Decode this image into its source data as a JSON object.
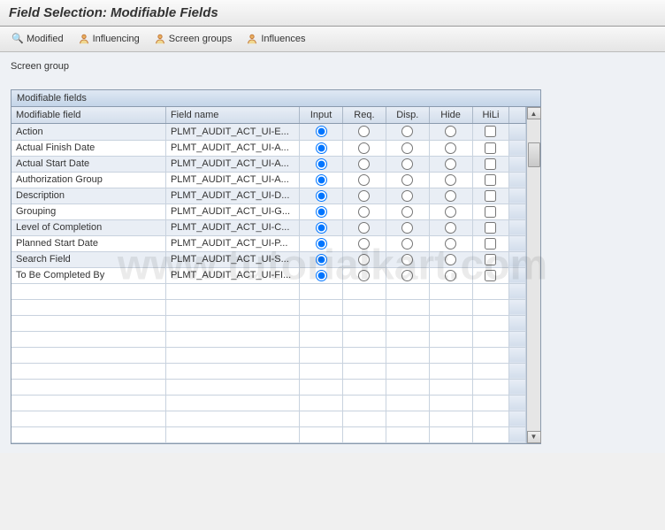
{
  "header": {
    "title": "Field Selection: Modifiable Fields"
  },
  "toolbar": [
    {
      "icon": "magnify",
      "label": "Modified"
    },
    {
      "icon": "person",
      "label": "Influencing"
    },
    {
      "icon": "person",
      "label": "Screen groups"
    },
    {
      "icon": "person",
      "label": "Influences"
    }
  ],
  "screen_group_label": "Screen group",
  "table": {
    "title": "Modifiable fields",
    "columns": {
      "field": "Modifiable field",
      "name": "Field name",
      "input": "Input",
      "req": "Req.",
      "disp": "Disp.",
      "hide": "Hide",
      "hili": "HiLi"
    },
    "rows": [
      {
        "field": "Action",
        "name": "PLMT_AUDIT_ACT_UI-E...",
        "sel": "input",
        "hili": false
      },
      {
        "field": "Actual Finish Date",
        "name": "PLMT_AUDIT_ACT_UI-A...",
        "sel": "input",
        "hili": false
      },
      {
        "field": "Actual Start Date",
        "name": "PLMT_AUDIT_ACT_UI-A...",
        "sel": "input",
        "hili": false
      },
      {
        "field": "Authorization Group",
        "name": "PLMT_AUDIT_ACT_UI-A...",
        "sel": "input",
        "hili": false
      },
      {
        "field": "Description",
        "name": "PLMT_AUDIT_ACT_UI-D...",
        "sel": "input",
        "hili": false
      },
      {
        "field": "Grouping",
        "name": "PLMT_AUDIT_ACT_UI-G...",
        "sel": "input",
        "hili": false
      },
      {
        "field": "Level of Completion",
        "name": "PLMT_AUDIT_ACT_UI-C...",
        "sel": "input",
        "hili": false
      },
      {
        "field": "Planned Start Date",
        "name": "PLMT_AUDIT_ACT_UI-P...",
        "sel": "input",
        "hili": false
      },
      {
        "field": "Search Field",
        "name": "PLMT_AUDIT_ACT_UI-S...",
        "sel": "input",
        "hili": false
      },
      {
        "field": "To Be Completed By",
        "name": "PLMT_AUDIT_ACT_UI-FI...",
        "sel": "input",
        "hili": false
      }
    ],
    "empty_rows": 10
  }
}
